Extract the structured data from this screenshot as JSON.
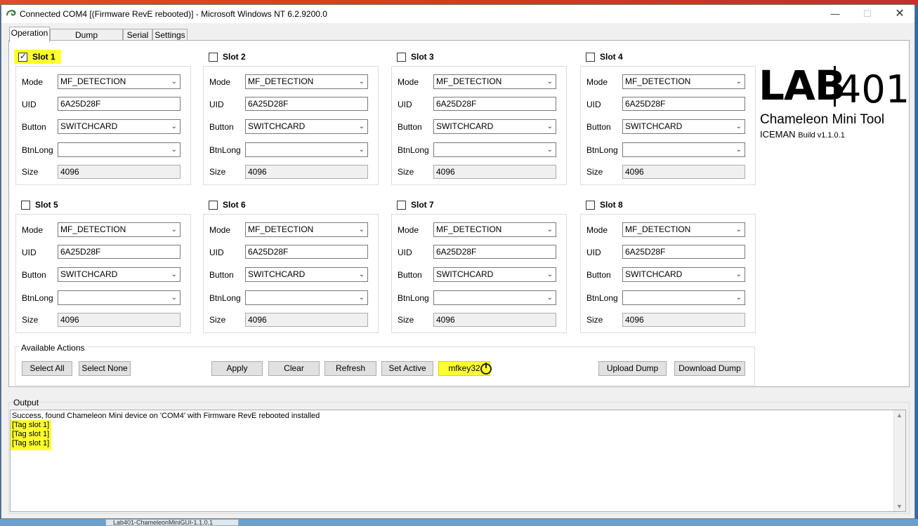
{
  "window": {
    "title": "Connected COM4 [(Firmware RevE rebooted)] - Microsoft Windows NT 6.2.9200.0",
    "taskbar_item": "Lab401-ChameleonMiniGUI-1.1.0.1"
  },
  "tabs": [
    "Operation",
    "Dump Management",
    "Serial",
    "Settings"
  ],
  "labels": {
    "mode": "Mode",
    "uid": "UID",
    "button": "Button",
    "btnlong": "BtnLong",
    "size": "Size"
  },
  "slots": [
    {
      "title": "Slot 1",
      "checked": true,
      "mode": "MF_DETECTION",
      "uid": "6A25D28F",
      "button": "SWITCHCARD",
      "btnlong": "",
      "size": "4096"
    },
    {
      "title": "Slot 2",
      "checked": false,
      "mode": "MF_DETECTION",
      "uid": "6A25D28F",
      "button": "SWITCHCARD",
      "btnlong": "",
      "size": "4096"
    },
    {
      "title": "Slot 3",
      "checked": false,
      "mode": "MF_DETECTION",
      "uid": "6A25D28F",
      "button": "SWITCHCARD",
      "btnlong": "",
      "size": "4096"
    },
    {
      "title": "Slot 4",
      "checked": false,
      "mode": "MF_DETECTION",
      "uid": "6A25D28F",
      "button": "SWITCHCARD",
      "btnlong": "",
      "size": "4096"
    },
    {
      "title": "Slot 5",
      "checked": false,
      "mode": "MF_DETECTION",
      "uid": "6A25D28F",
      "button": "SWITCHCARD",
      "btnlong": "",
      "size": "4096"
    },
    {
      "title": "Slot 6",
      "checked": false,
      "mode": "MF_DETECTION",
      "uid": "6A25D28F",
      "button": "SWITCHCARD",
      "btnlong": "",
      "size": "4096"
    },
    {
      "title": "Slot 7",
      "checked": false,
      "mode": "MF_DETECTION",
      "uid": "6A25D28F",
      "button": "SWITCHCARD",
      "btnlong": "",
      "size": "4096"
    },
    {
      "title": "Slot 8",
      "checked": false,
      "mode": "MF_DETECTION",
      "uid": "6A25D28F",
      "button": "SWITCHCARD",
      "btnlong": "",
      "size": "4096"
    }
  ],
  "logo": {
    "lab": "LAB",
    "num": "401",
    "product": "Chameleon Mini Tool",
    "iceman": "ICEMAN",
    "build": "Build v1.1.0.1"
  },
  "actions": {
    "group_label": "Available Actions",
    "select_all": "Select All",
    "select_none": "Select None",
    "apply": "Apply",
    "clear": "Clear",
    "refresh": "Refresh",
    "set_active": "Set Active",
    "mfkey32": "mfkey32",
    "upload_dump": "Upload Dump",
    "download_dump": "Download Dump"
  },
  "output": {
    "label": "Output",
    "lines": [
      "Success, found Chameleon Mini device on 'COM4' with Firmware RevE rebooted installed",
      "[Tag slot 1]",
      "[Tag slot 1]",
      "[Tag slot 1]"
    ]
  },
  "colors": {
    "highlight": "#ffff2e",
    "desktop_accent": "#d13a1f"
  }
}
